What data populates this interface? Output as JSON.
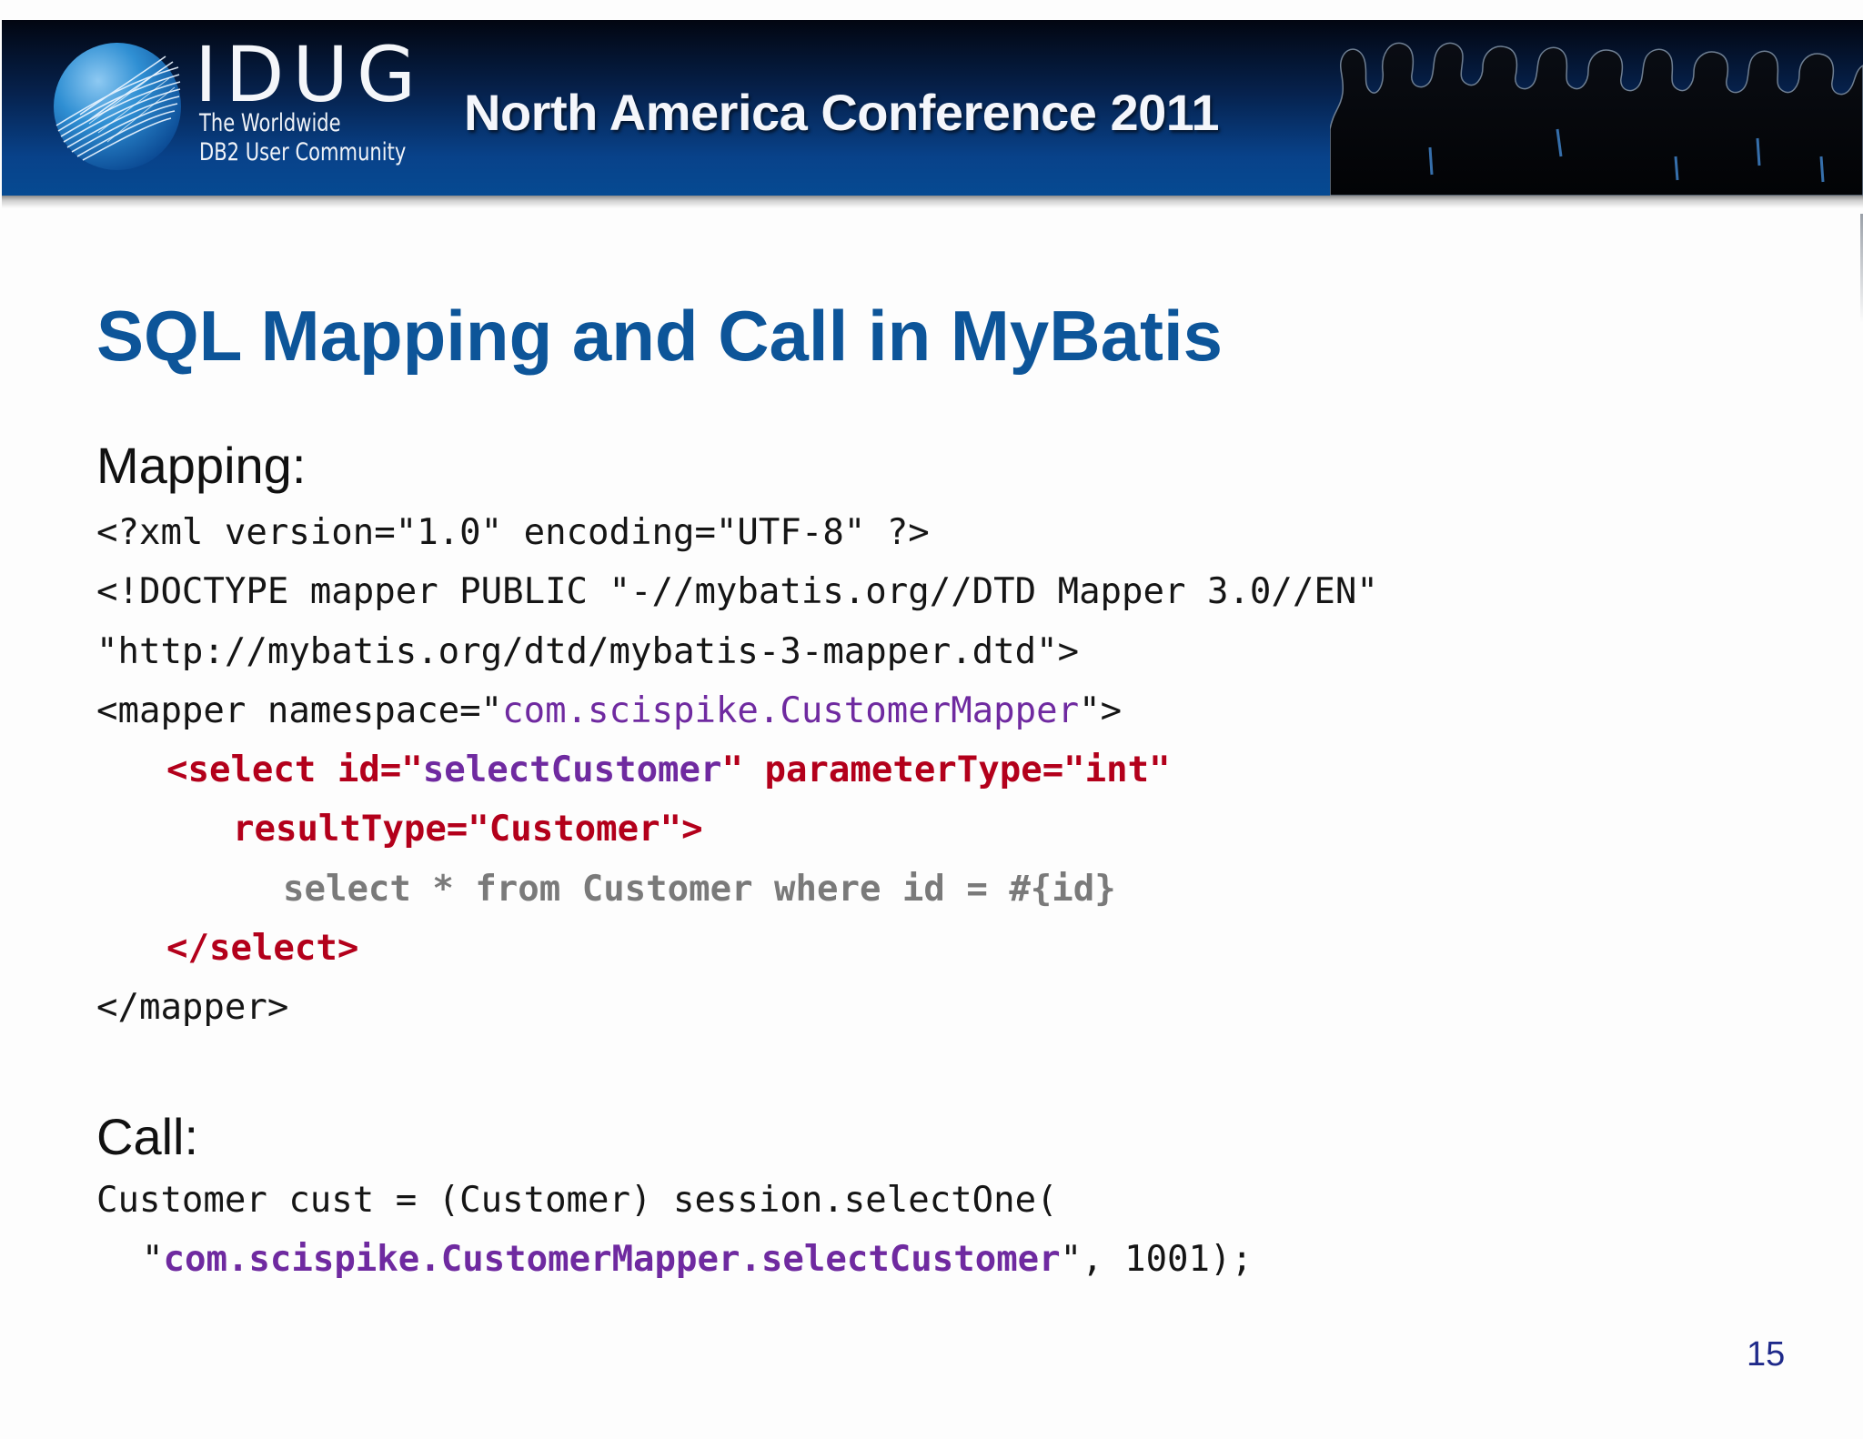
{
  "banner": {
    "logo_text": "IDUG",
    "logo_tagline_1": "The Worldwide",
    "logo_tagline_2": "DB2 User Community",
    "conference_title": "North America Conference 2011"
  },
  "slide": {
    "title": "SQL Mapping and Call in MyBatis",
    "mapping_label": "Mapping:",
    "mapping_code": {
      "line1": "<?xml version=\"1.0\" encoding=\"UTF-8\" ?>",
      "line2": "<!DOCTYPE mapper PUBLIC \"-//mybatis.org//DTD Mapper 3.0//EN\"",
      "line3": "\"http://mybatis.org/dtd/mybatis-3-mapper.dtd\">",
      "line4_prefix": "<mapper namespace=\"",
      "line4_namespace": "com.scispike.CustomerMapper",
      "line4_suffix": "\">",
      "line5_prefix": "<select id=\"",
      "line5_id": "selectCustomer",
      "line5_suffix": "\" parameterType=\"int\"",
      "line6": "resultType=\"Customer\">",
      "line7": "select * from Customer where id = #{id}",
      "line8": "</select>",
      "line9": "</mapper>"
    },
    "call_label": "Call:",
    "call_code": {
      "line1": "Customer cust = (Customer) session.selectOne(",
      "line2_prefix": "\"",
      "line2_statement": "com.scispike.CustomerMapper.selectCustomer",
      "line2_suffix": "\", 1001);"
    },
    "page_number": "15"
  },
  "colors": {
    "title_blue": "#0d5599",
    "code_purple": "#6f2aa0",
    "code_red": "#b3001b",
    "code_gray": "#7a7a7a",
    "banner_dark": "#020611",
    "banner_blue": "#064a92"
  }
}
